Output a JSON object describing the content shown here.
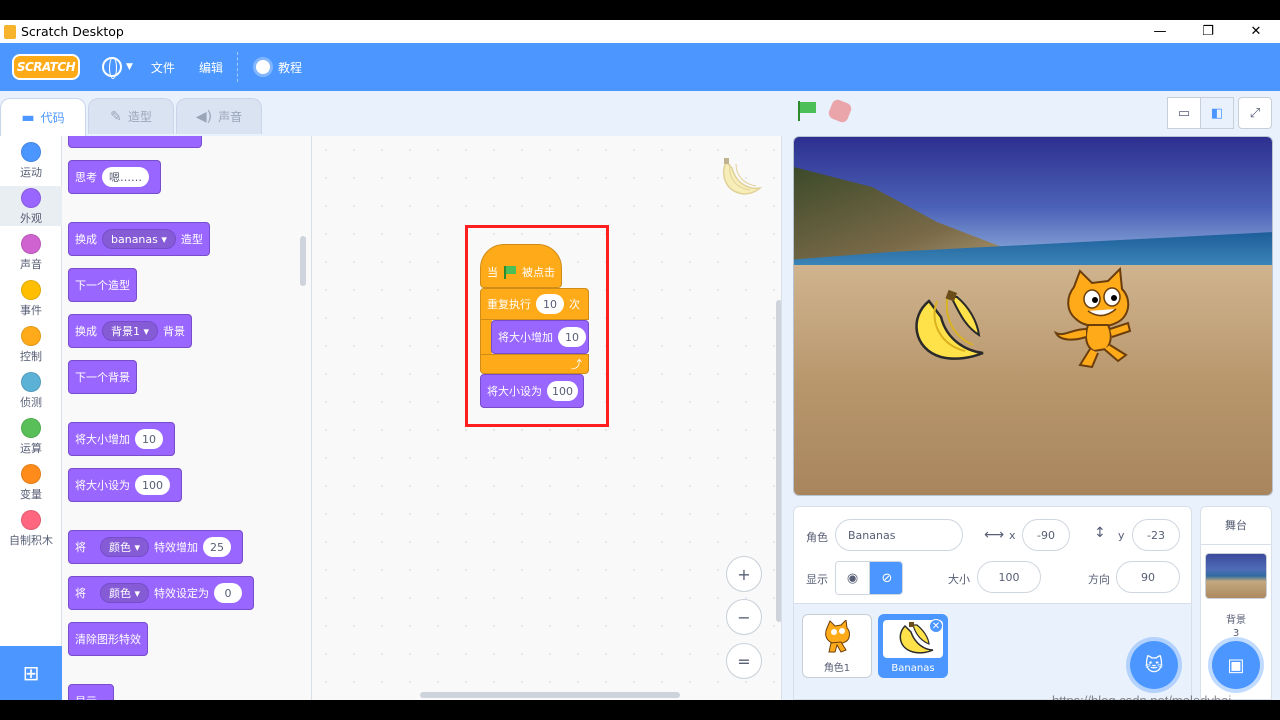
{
  "window": {
    "title": "Scratch Desktop",
    "minimize": "—",
    "restore": "❐",
    "close": "✕"
  },
  "menubar": {
    "logo": "SCRATCH",
    "file": "文件",
    "edit": "编辑",
    "tutorials": "教程"
  },
  "tabs": [
    {
      "label": "代码",
      "icon": "code-icon"
    },
    {
      "label": "造型",
      "icon": "brush-icon"
    },
    {
      "label": "声音",
      "icon": "speaker-icon"
    }
  ],
  "categories": [
    {
      "label": "运动",
      "color": "#4c97ff"
    },
    {
      "label": "外观",
      "color": "#9966ff"
    },
    {
      "label": "声音",
      "color": "#cf63cf"
    },
    {
      "label": "事件",
      "color": "#ffbf00"
    },
    {
      "label": "控制",
      "color": "#ffab19"
    },
    {
      "label": "侦测",
      "color": "#5cb1d6"
    },
    {
      "label": "运算",
      "color": "#59c059"
    },
    {
      "label": "变量",
      "color": "#ff8c1a"
    },
    {
      "label": "自制积木",
      "color": "#ff6680"
    }
  ],
  "palette": {
    "think": "思考",
    "think_value": "嗯……",
    "switch_costume": "换成",
    "costume_value": "bananas",
    "costume_suffix": "造型",
    "next_costume": "下一个造型",
    "switch_backdrop": "换成",
    "backdrop_value": "背景1",
    "backdrop_suffix": "背景",
    "next_backdrop": "下一个背景",
    "change_size": "将大小增加",
    "change_size_value": "10",
    "set_size": "将大小设为",
    "set_size_value": "100",
    "effect_prefix": "将",
    "effect_value": "颜色",
    "change_effect": "特效增加",
    "change_effect_value": "25",
    "set_effect": "特效设定为",
    "set_effect_value": "0",
    "clear_effects": "清除图形特效",
    "show": "显示"
  },
  "script": {
    "when": "当",
    "flag_clicked": "被点击",
    "repeat": "重复执行",
    "repeat_value": "10",
    "repeat_suffix": "次",
    "change_size": "将大小增加",
    "change_size_value": "10",
    "set_size": "将大小设为",
    "set_size_value": "100"
  },
  "zoom": {
    "in": "+",
    "out": "−",
    "reset": "="
  },
  "sprite_info": {
    "sprite_label": "角色",
    "sprite_name": "Bananas",
    "x_label": "x",
    "x_value": "-90",
    "y_label": "y",
    "y_value": "-23",
    "show_label": "显示",
    "size_label": "大小",
    "size_value": "100",
    "direction_label": "方向",
    "direction_value": "90"
  },
  "sprites": [
    {
      "name": "角色1",
      "selected": false
    },
    {
      "name": "Bananas",
      "selected": true
    }
  ],
  "stage_panel": {
    "title": "舞台",
    "backdrop_label": "背景",
    "backdrop_count": "3"
  },
  "watermark": "https://blog.csdn.net/melodybai"
}
